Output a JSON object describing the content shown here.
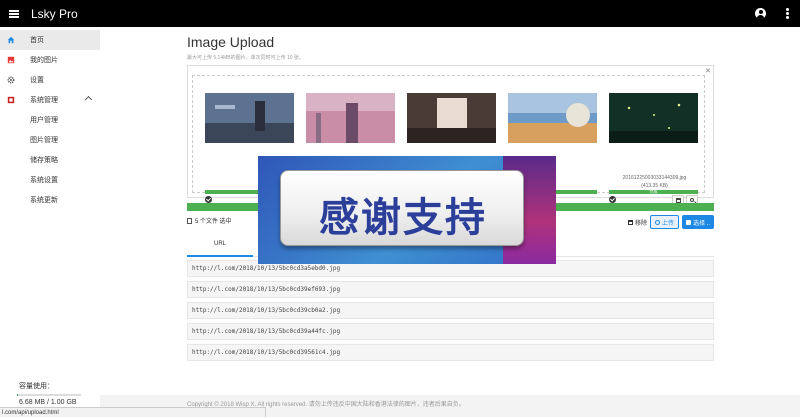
{
  "app": {
    "brand": "Lsky Pro"
  },
  "sidebar": {
    "items": [
      {
        "label": "首页",
        "icon": "home-icon",
        "active": true
      },
      {
        "label": "我的图片",
        "icon": "image-icon"
      },
      {
        "label": "设置",
        "icon": "gear-icon"
      },
      {
        "label": "系统管理",
        "icon": "system-icon",
        "expanded": true
      },
      {
        "label": "用户管理"
      },
      {
        "label": "图片管理"
      },
      {
        "label": "储存策略"
      },
      {
        "label": "系统设置"
      },
      {
        "label": "系统更新"
      }
    ],
    "storage_label": "容量使用：",
    "storage_value": "6.68 MB / 1.00 GB",
    "storage_fraction": 0.0065
  },
  "status_url": "l.com/api/upload.html",
  "page": {
    "title": "Image Upload",
    "hint": "最大可上传 5.14MB的图片，单次同时可上传 10 张。"
  },
  "cards": [
    {
      "name": "",
      "size": "",
      "progress_label": ""
    },
    {
      "name": "",
      "size": "",
      "progress_label": ""
    },
    {
      "name": "",
      "size": "",
      "progress_label": ""
    },
    {
      "name": "",
      "size": "",
      "progress_label": ""
    },
    {
      "name": "20161225003033144309.jpg",
      "size": "(413.35 KB)",
      "progress_label": "完成"
    }
  ],
  "uploader": {
    "count": "5 个文件 选中",
    "remove": "移除",
    "upload": "上传",
    "choose": "选择 .."
  },
  "tabs": {
    "url": "URL"
  },
  "urls": [
    "http://l.com/2018/10/13/5bc0cd3a5ebd0.jpg",
    "http://l.com/2018/10/13/5bc0cd39ef693.jpg",
    "http://l.com/2018/10/13/5bc0cd39cb0a2.jpg",
    "http://l.com/2018/10/13/5bc0cd39a44fc.jpg",
    "http://l.com/2018/10/13/5bc0cd39561c4.jpg"
  ],
  "overlay": {
    "text": "感谢支持"
  },
  "footer": {
    "text": "Copyright © 2018 Wisp X. All rights reserved. 请勿上传违反中国大陆和香港法律的图片，违者后果自负。"
  },
  "colors": {
    "accent": "#1e88e5",
    "progress": "#4caf50"
  }
}
